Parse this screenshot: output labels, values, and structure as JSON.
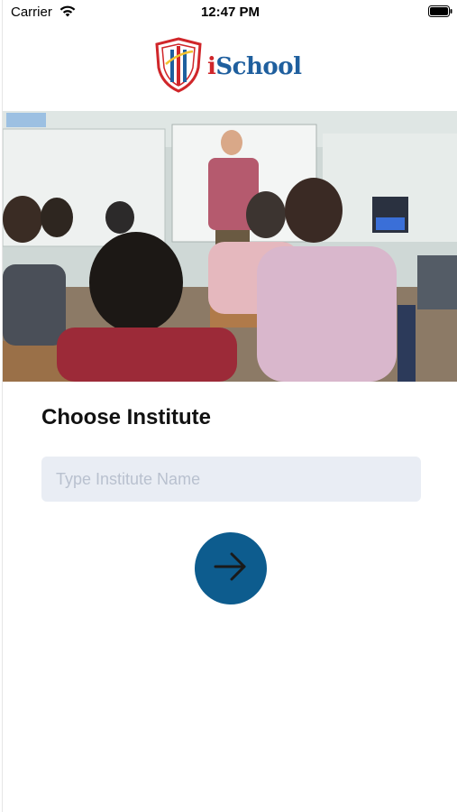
{
  "status_bar": {
    "carrier": "Carrier",
    "time": "12:47 PM"
  },
  "logo": {
    "text_prefix": "i",
    "text_main": "School"
  },
  "hero": {
    "description": "classroom-photo"
  },
  "form": {
    "heading": "Choose Institute",
    "input_placeholder": "Type Institute Name",
    "input_value": ""
  },
  "colors": {
    "brand_blue": "#1f5f9e",
    "brand_red": "#d0262a",
    "button": "#0d5c8e",
    "input_bg": "#e9edf4"
  },
  "icons": {
    "submit": "arrow-right-icon",
    "wifi": "wifi-icon",
    "battery": "battery-icon"
  }
}
